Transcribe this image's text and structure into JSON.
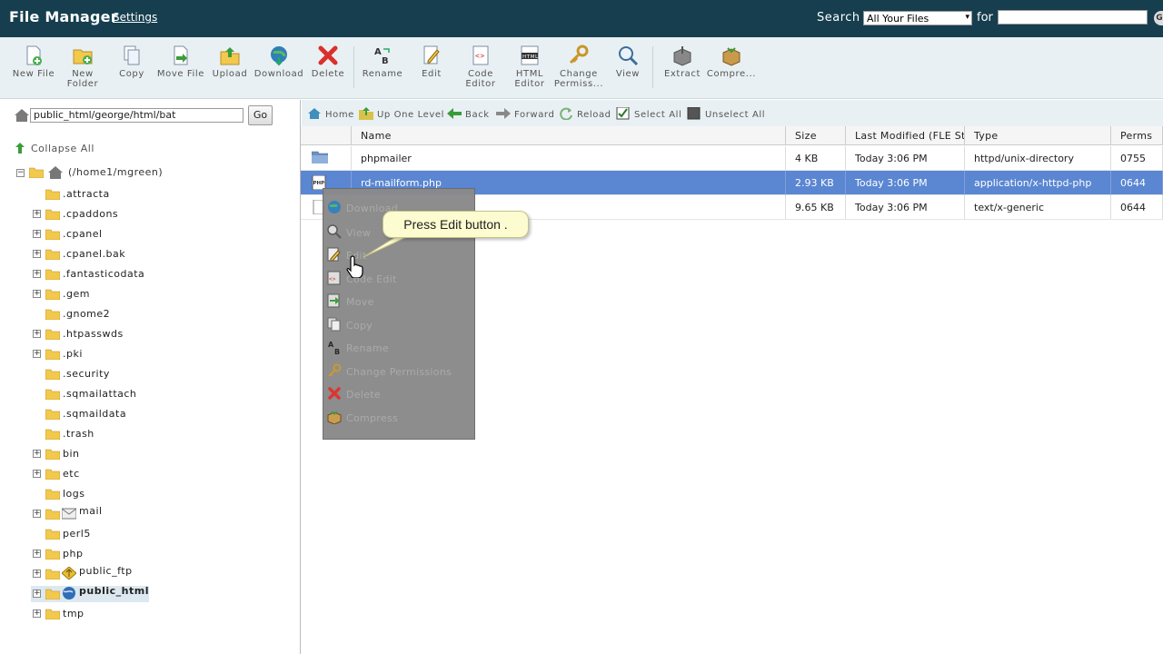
{
  "header": {
    "title": "File Manager",
    "settings_link": "Settings",
    "search_label": "Search",
    "search_scope": "All Your Files",
    "for_label": "for",
    "search_value": "",
    "go_icon": "Go"
  },
  "toolbar": {
    "buttons": [
      {
        "label": "New File",
        "icon": "new-file-icon"
      },
      {
        "label": "New Folder",
        "icon": "new-folder-icon"
      },
      {
        "label": "Copy",
        "icon": "copy-icon"
      },
      {
        "label": "Move File",
        "icon": "move-file-icon"
      },
      {
        "label": "Upload",
        "icon": "upload-icon"
      },
      {
        "label": "Download",
        "icon": "download-icon"
      },
      {
        "label": "Delete",
        "icon": "delete-icon"
      },
      {
        "label": "Rename",
        "icon": "rename-icon"
      },
      {
        "label": "Edit",
        "icon": "edit-icon"
      },
      {
        "label": "Code Editor",
        "icon": "code-editor-icon"
      },
      {
        "label": "HTML Editor",
        "icon": "html-editor-icon"
      },
      {
        "label": "Change Permiss...",
        "icon": "key-icon"
      },
      {
        "label": "View",
        "icon": "magnifier-icon"
      },
      {
        "label": "Extract",
        "icon": "extract-icon"
      },
      {
        "label": "Compre...",
        "icon": "compress-icon"
      }
    ]
  },
  "left": {
    "path_value": "public_html/george/html/bat",
    "go_label": "Go",
    "collapse_all": "Collapse All",
    "root_label": "(/home1/mgreen)",
    "tree": [
      {
        "label": ".attracta",
        "expandable": false
      },
      {
        "label": ".cpaddons",
        "expandable": true
      },
      {
        "label": ".cpanel",
        "expandable": true
      },
      {
        "label": ".cpanel.bak",
        "expandable": true
      },
      {
        "label": ".fantasticodata",
        "expandable": true
      },
      {
        "label": ".gem",
        "expandable": true
      },
      {
        "label": ".gnome2",
        "expandable": false
      },
      {
        "label": ".htpasswds",
        "expandable": true
      },
      {
        "label": ".pki",
        "expandable": true
      },
      {
        "label": ".security",
        "expandable": false
      },
      {
        "label": ".sqmailattach",
        "expandable": false
      },
      {
        "label": ".sqmaildata",
        "expandable": false
      },
      {
        "label": ".trash",
        "expandable": false
      },
      {
        "label": "bin",
        "expandable": true
      },
      {
        "label": "etc",
        "expandable": true
      },
      {
        "label": "logs",
        "expandable": false
      },
      {
        "label": "mail",
        "expandable": true
      },
      {
        "label": "perl5",
        "expandable": false
      },
      {
        "label": "php",
        "expandable": true
      },
      {
        "label": "public_ftp",
        "expandable": true
      },
      {
        "label": "public_html",
        "expandable": true
      },
      {
        "label": "tmp",
        "expandable": true
      }
    ]
  },
  "nav": {
    "home": "Home",
    "up": "Up One Level",
    "back": "Back",
    "forward": "Forward",
    "reload": "Reload",
    "select_all": "Select All",
    "unselect_all": "Unselect All"
  },
  "table": {
    "headers": [
      "Name",
      "Size",
      "Last Modified (FLE Stand",
      "Type",
      "Perms"
    ],
    "rows": [
      {
        "name": "phpmailer",
        "size": "4 KB",
        "modified": "Today 3:06 PM",
        "type": "httpd/unix-directory",
        "perms": "0755"
      },
      {
        "name": "rd-mailform.php",
        "size": "2.93 KB",
        "modified": "Today 3:06 PM",
        "type": "application/x-httpd-php",
        "perms": "0644"
      },
      {
        "name": "",
        "size": "9.65 KB",
        "modified": "Today 3:06 PM",
        "type": "text/x-generic",
        "perms": "0644"
      }
    ]
  },
  "context_menu": {
    "items": [
      "Download",
      "View",
      "Edit",
      "Code Edit",
      "Move",
      "Copy",
      "Rename",
      "Change Permissions",
      "Delete",
      "Compress"
    ]
  },
  "tooltip": {
    "text": "Press Edit button ."
  },
  "colors": {
    "header_bg": "#163e4e",
    "toolbar_bg": "#e9f0f3",
    "selected_row": "#5a86d2",
    "tooltip_bg": "#fdfbd0"
  }
}
